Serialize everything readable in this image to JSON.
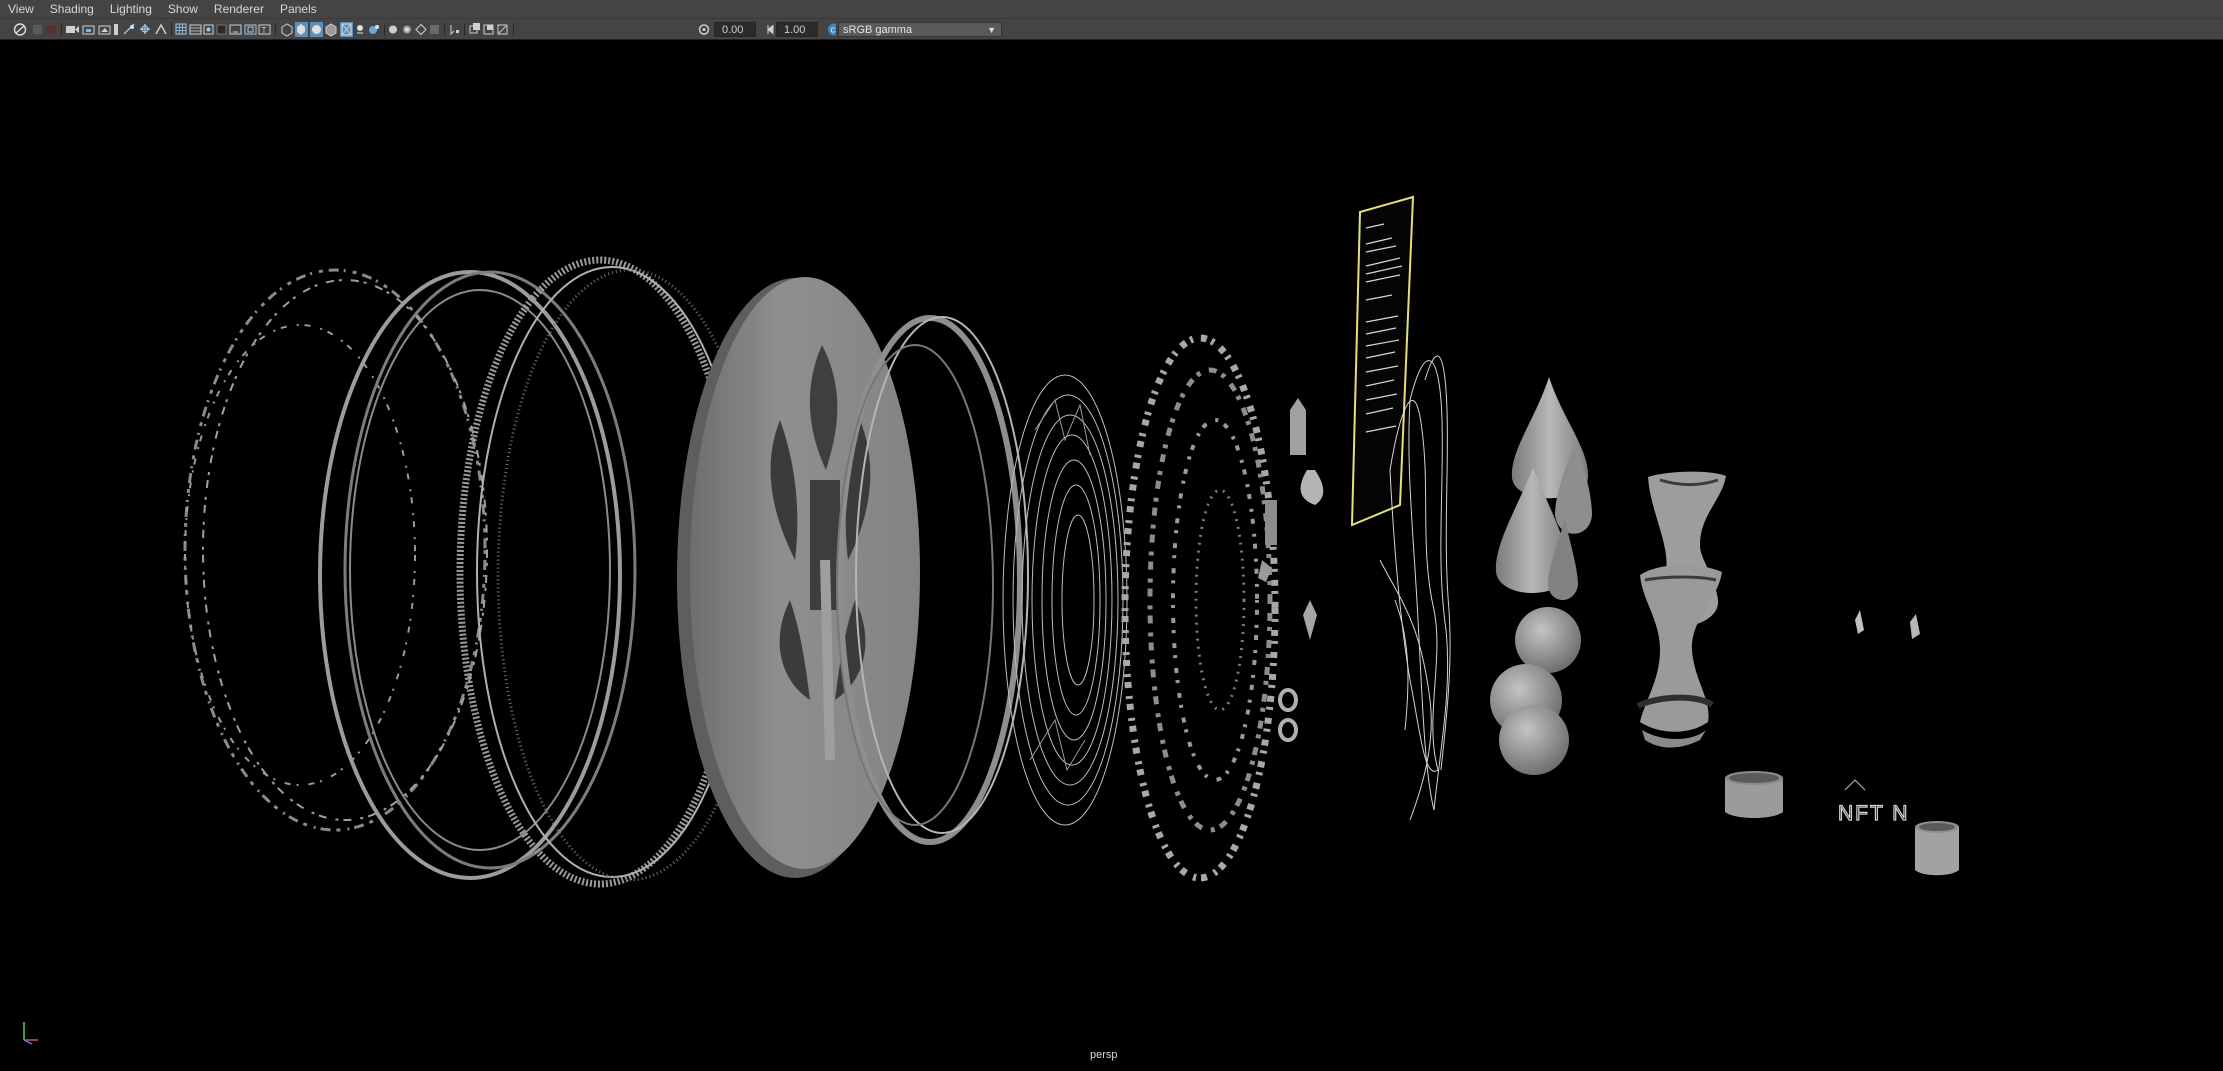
{
  "menubar": {
    "items": [
      "View",
      "Shading",
      "Lighting",
      "Show",
      "Renderer",
      "Panels"
    ]
  },
  "toolbar": {
    "exposure_value": "0.00",
    "gamma_value": "1.00",
    "color_space": "sRGB gamma",
    "icons": [
      "select-camera-icon",
      "lock-camera-icon",
      "camera-attributes-icon",
      "bookmark-icon",
      "image-plane-icon",
      "grid-icon",
      "film-gate-icon",
      "resolution-gate-icon",
      "gate-mask-icon",
      "field-chart-icon",
      "safe-action-icon",
      "safe-title-icon",
      "wireframe-icon",
      "smooth-shade-icon",
      "default-material-icon",
      "textured-icon",
      "lights-icon",
      "shadows-icon",
      "screen-space-ao-icon",
      "motion-blur-icon",
      "anti-alias-icon",
      "depth-of-field-icon",
      "isolate-select-icon",
      "xray-icon",
      "xray-joints-icon",
      "backface-icon",
      "exposure-icon",
      "gamma-icon",
      "view-transform-icon"
    ]
  },
  "viewport": {
    "camera_label": "persp",
    "coin_caption_text": "NFT N"
  },
  "colors": {
    "menubar_bg": "#444444",
    "viewport_bg": "#000000",
    "mesh_gray": "#9a9a9a",
    "wire_gray": "#c0c0c0",
    "highlight_yellow": "#e6e07a"
  }
}
